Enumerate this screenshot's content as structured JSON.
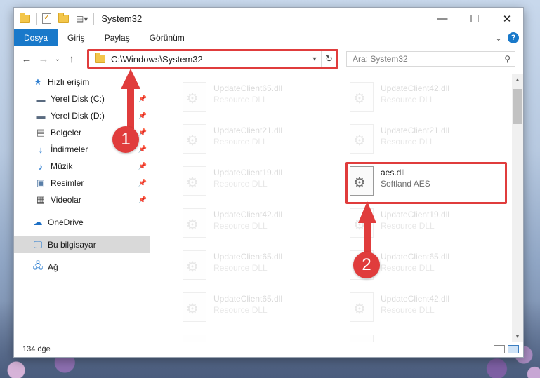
{
  "window": {
    "title": "System32",
    "controls": {
      "minimize": "—",
      "maximize": "☐",
      "close": "✕"
    }
  },
  "ribbon": {
    "tabs": [
      {
        "label": "Dosya",
        "active": true
      },
      {
        "label": "Giriş",
        "active": false
      },
      {
        "label": "Paylaş",
        "active": false
      },
      {
        "label": "Görünüm",
        "active": false
      }
    ],
    "help": "?",
    "expand": "⌄"
  },
  "nav": {
    "back": "←",
    "forward": "→",
    "recent": "⌄",
    "up": "↑",
    "address": "C:\\Windows\\System32",
    "search_placeholder": "Ara: System32"
  },
  "sidebar": {
    "items": [
      {
        "label": "Hızlı erişim",
        "icon": "star-icon"
      },
      {
        "label": "Yerel Disk (C:)",
        "icon": "drive-icon",
        "pinned": true
      },
      {
        "label": "Yerel Disk (D:)",
        "icon": "drive-icon",
        "pinned": true
      },
      {
        "label": "Belgeler",
        "icon": "documents-icon",
        "pinned": true
      },
      {
        "label": "İndirmeler",
        "icon": "download-icon",
        "pinned": true
      },
      {
        "label": "Müzik",
        "icon": "music-icon",
        "pinned": true
      },
      {
        "label": "Resimler",
        "icon": "pictures-icon",
        "pinned": true
      },
      {
        "label": "Videolar",
        "icon": "videos-icon",
        "pinned": true
      },
      {
        "label": "OneDrive",
        "icon": "cloud-icon"
      },
      {
        "label": "Bu bilgisayar",
        "icon": "computer-icon",
        "selected": true
      },
      {
        "label": "Ağ",
        "icon": "network-icon"
      }
    ]
  },
  "files": [
    {
      "name": "UpdateClient65.dll",
      "type": "Resource DLL",
      "faded": true
    },
    {
      "name": "UpdateClient42.dll",
      "type": "Resource DLL",
      "faded": true
    },
    {
      "name": "UpdateClient21.dll",
      "type": "Resource DLL",
      "faded": true
    },
    {
      "name": "UpdateClient21.dll",
      "type": "Resource DLL",
      "faded": true
    },
    {
      "name": "UpdateClient19.dll",
      "type": "Resource DLL",
      "faded": true
    },
    {
      "name": "aes.dll",
      "type": "Softland AES",
      "faded": false,
      "highlighted": true
    },
    {
      "name": "UpdateClient42.dll",
      "type": "Resource DLL",
      "faded": true
    },
    {
      "name": "UpdateClient19.dll",
      "type": "Resource DLL",
      "faded": true
    },
    {
      "name": "UpdateClient65.dll",
      "type": "Resource DLL",
      "faded": true
    },
    {
      "name": "UpdateClient65.dll",
      "type": "Resource DLL",
      "faded": true
    },
    {
      "name": "UpdateClient65.dll",
      "type": "Resource DLL",
      "faded": true
    },
    {
      "name": "UpdateClient42.dll",
      "type": "Resource DLL",
      "faded": true
    },
    {
      "name": "",
      "type": "",
      "faded": true
    },
    {
      "name": "",
      "type": "",
      "faded": true
    }
  ],
  "status": {
    "count": "134 öğe"
  },
  "annotations": {
    "step1": "1",
    "step2": "2",
    "color": "#e03c3c"
  }
}
